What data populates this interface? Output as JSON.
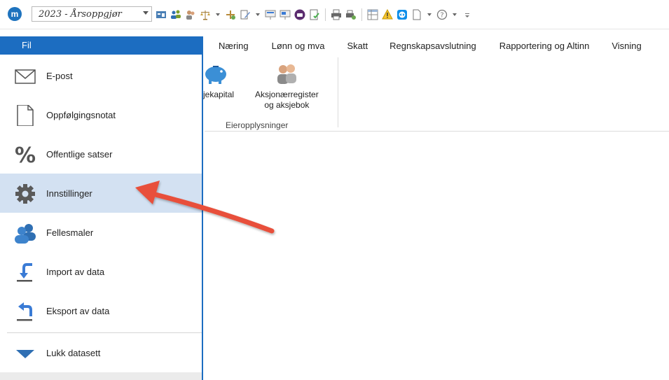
{
  "app": {
    "logo_letter": "m",
    "dataset_combo": "2023 - Årsoppgjør"
  },
  "quick_access_icons": [
    "window-icon",
    "users-icon",
    "person-icon",
    "scale-icon",
    "tools-icon",
    "edit-icon",
    "presentation-icon",
    "presentation-alt-icon",
    "brand-icon",
    "document-check-icon",
    "print-icon",
    "print-edit-icon",
    "table-icon",
    "warning-icon",
    "teamviewer-icon",
    "new-document-icon",
    "help-icon"
  ],
  "ribbon": {
    "file_tab": "Fil",
    "tabs": [
      "Næring",
      "Lønn og mva",
      "Skatt",
      "Regnskapsavslutning",
      "Rapportering og Altinn",
      "Visning"
    ],
    "buttons": {
      "aksjekapital": "sjekapital",
      "aksjonaer_line1": "Aksjonærregister",
      "aksjonaer_line2": "og aksjebok"
    },
    "group_label": "Eieropplysninger"
  },
  "backstage": {
    "items": [
      {
        "label": "E-post",
        "icon": "envelope-icon"
      },
      {
        "label": "Oppfølgingsnotat",
        "icon": "document-icon"
      },
      {
        "label": "Offentlige satser",
        "icon": "percent-icon"
      },
      {
        "label": "Innstillinger",
        "icon": "gear-icon",
        "active": true
      },
      {
        "label": "Fellesmaler",
        "icon": "users-icon"
      },
      {
        "label": "Import av data",
        "icon": "import-icon"
      },
      {
        "label": "Eksport av data",
        "icon": "export-icon"
      },
      {
        "label": "Lukk datasett",
        "icon": "triangle-down-icon"
      }
    ]
  },
  "colors": {
    "accent": "#1c6dc1",
    "active_item": "#d3e1f2",
    "arrow": "#e8503a"
  }
}
